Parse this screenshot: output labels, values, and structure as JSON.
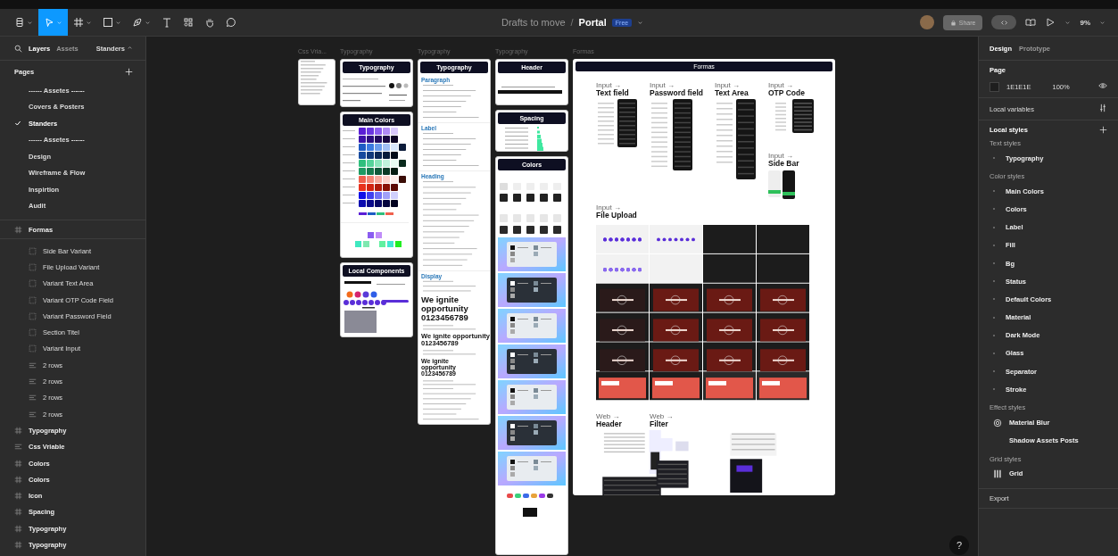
{
  "toolbar": {
    "tools": [
      {
        "kind": "main-menu",
        "selected": false
      },
      {
        "kind": "move",
        "selected": true
      },
      {
        "kind": "frame",
        "selected": false
      },
      {
        "kind": "shape",
        "selected": false
      },
      {
        "kind": "pen",
        "selected": false
      },
      {
        "kind": "text",
        "selected": false
      },
      {
        "kind": "resources",
        "selected": false
      },
      {
        "kind": "hand",
        "selected": false
      },
      {
        "kind": "comment",
        "selected": false
      }
    ]
  },
  "breadcrumb": {
    "folder": "Drafts to move",
    "separator": "/",
    "file": "Portal",
    "badge": "Free"
  },
  "header_right": {
    "share": "Share",
    "dev_mode": false,
    "zoom": "9%"
  },
  "left_panel": {
    "tabs": [
      {
        "label": "Layers",
        "selected": true
      },
      {
        "label": "Assets",
        "selected": false
      }
    ],
    "page_menu": "Standers",
    "pages_title": "Pages",
    "pages": [
      {
        "label": "------ Assetes ------",
        "selected": false
      },
      {
        "label": "Covers & Posters",
        "selected": false
      },
      {
        "label": "Standers",
        "selected": true
      },
      {
        "label": "------ Assetes ------",
        "selected": false
      },
      {
        "label": "Design",
        "selected": false
      },
      {
        "label": "Wireframe & Flow",
        "selected": false
      },
      {
        "label": "Inspirtion",
        "selected": false
      },
      {
        "label": "Audit",
        "selected": false
      }
    ],
    "layers": [
      {
        "name": "Formas",
        "kind": "frame",
        "children": [
          {
            "name": "Side Bar Variant",
            "kind": "component-set"
          },
          {
            "name": "File Upload Variant",
            "kind": "component-set"
          },
          {
            "name": "Variant Text Area",
            "kind": "component-set"
          },
          {
            "name": "Variant OTP Code Field",
            "kind": "component-set"
          },
          {
            "name": "Variant Password Field",
            "kind": "component-set"
          },
          {
            "name": "Section Titel",
            "kind": "component-set"
          },
          {
            "name": "Variant Input",
            "kind": "component-set"
          },
          {
            "name": "2 rows",
            "kind": "auto-layout"
          },
          {
            "name": "2 rows",
            "kind": "auto-layout"
          },
          {
            "name": "2 rows",
            "kind": "auto-layout"
          },
          {
            "name": "2 rows",
            "kind": "auto-layout"
          }
        ]
      },
      {
        "name": "Typography",
        "kind": "frame"
      },
      {
        "name": "Css Vriable",
        "kind": "auto-layout"
      },
      {
        "name": "Colors",
        "kind": "frame"
      },
      {
        "name": "Colors",
        "kind": "frame"
      },
      {
        "name": "Icon",
        "kind": "frame"
      },
      {
        "name": "Spacing",
        "kind": "frame"
      },
      {
        "name": "Typography",
        "kind": "frame"
      },
      {
        "name": "Typography",
        "kind": "frame"
      }
    ]
  },
  "canvas": {
    "columns": [
      {
        "label": "Css Vria...",
        "cards": [
          {
            "kind": "css-variables"
          }
        ]
      },
      {
        "label": "Typography",
        "cards": [
          {
            "kind": "typography-summary",
            "title": "Typography"
          },
          {
            "kind": "main-colors",
            "title": "Main Colors"
          },
          {
            "kind": "local-components",
            "title": "Local Components"
          }
        ]
      },
      {
        "label": "Typography",
        "cards": [
          {
            "kind": "typography-scale",
            "title": "Typography",
            "sections": [
              {
                "title": "Paragraph"
              },
              {
                "title": "Label"
              },
              {
                "title": "Heading"
              },
              {
                "title": "Display",
                "samples": [
                  "We ignite opportunity 0123456789",
                  "We ignite opportunity 0123456789",
                  "We ignite opportunity 0123456789"
                ]
              }
            ]
          }
        ]
      },
      {
        "label": "Typography",
        "cards": [
          {
            "kind": "header",
            "title": "Header"
          },
          {
            "kind": "spacing",
            "title": "Spacing"
          },
          {
            "kind": "colors",
            "title": "Colors"
          }
        ]
      }
    ],
    "formas": {
      "label": "Formas",
      "title": "Formas",
      "sections": [
        {
          "kind": "text-field",
          "label": "Input →",
          "title": "Text field"
        },
        {
          "kind": "password-field",
          "label": "Input →",
          "title": "Password field"
        },
        {
          "kind": "text-area",
          "label": "Input →",
          "title": "Text Area"
        },
        {
          "kind": "otp-code",
          "label": "Input →",
          "title": "OTP Code"
        },
        {
          "kind": "side-bar",
          "label": "Input →",
          "title": "Side Bar"
        },
        {
          "kind": "file-upload",
          "label": "Input →",
          "title": "File Upload"
        },
        {
          "kind": "web-header",
          "label": "Web →",
          "title": "Header"
        },
        {
          "kind": "web-filter",
          "label": "Web →",
          "title": "Filter"
        }
      ]
    }
  },
  "right_panel": {
    "tabs": [
      {
        "label": "Design",
        "selected": true
      },
      {
        "label": "Prototype",
        "selected": false
      }
    ],
    "page_title": "Page",
    "page_color": {
      "value": "1E1E1E",
      "color": "#1e1e1e"
    },
    "page_opacity": "100%",
    "local_variables": "Local variables",
    "local_styles": "Local styles",
    "groups": [
      {
        "title": "Text styles",
        "items": [
          {
            "label": "Typography",
            "kind": "folder"
          }
        ]
      },
      {
        "title": "Color styles",
        "items": [
          {
            "label": "Main Colors",
            "kind": "folder"
          },
          {
            "label": "Colors",
            "kind": "folder"
          },
          {
            "label": "Label",
            "kind": "folder"
          },
          {
            "label": "Fill",
            "kind": "folder"
          },
          {
            "label": "Bg",
            "kind": "folder"
          },
          {
            "label": "Status",
            "kind": "folder"
          },
          {
            "label": "Default Colors",
            "kind": "folder"
          },
          {
            "label": "Material",
            "kind": "folder"
          },
          {
            "label": "Dark Mode",
            "kind": "folder"
          },
          {
            "label": "Glass",
            "kind": "folder"
          },
          {
            "label": "Separator",
            "kind": "folder"
          },
          {
            "label": "Stroke",
            "kind": "folder"
          }
        ]
      },
      {
        "title": "Effect styles",
        "items": [
          {
            "label": "Material Blur",
            "kind": "effect"
          },
          {
            "label": "Shadow Assets Posts",
            "kind": "plain"
          }
        ]
      },
      {
        "title": "Grid styles",
        "items": [
          {
            "label": "Grid",
            "kind": "grid"
          }
        ]
      }
    ],
    "export": "Export",
    "help": "?"
  }
}
